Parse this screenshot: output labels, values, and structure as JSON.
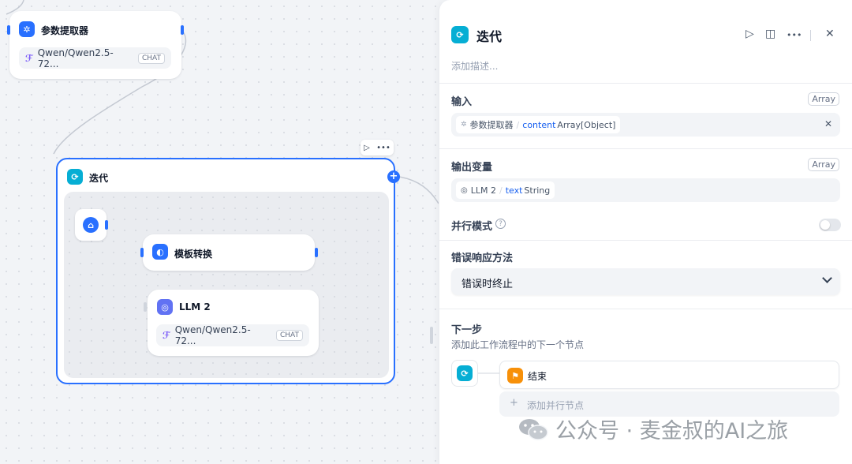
{
  "canvas": {
    "param_node": {
      "title": "参数提取器",
      "model": "Qwen/Qwen2.5-72...",
      "tag": "CHAT"
    },
    "iteration_node": {
      "title": "迭代"
    },
    "template_node": {
      "title": "模板转换"
    },
    "llm_node": {
      "title": "LLM 2",
      "model": "Qwen/Qwen2.5-72...",
      "tag": "CHAT"
    }
  },
  "panel": {
    "title": "迭代",
    "description_placeholder": "添加描述...",
    "input": {
      "label": "输入",
      "type_badge": "Array",
      "source_node": "参数提取器",
      "separator": "/",
      "var_name": "content",
      "var_type": "Array[Object]"
    },
    "output": {
      "label": "输出变量",
      "type_badge": "Array",
      "source_node": "LLM 2",
      "separator": "/",
      "var_name": "text",
      "var_type": "String"
    },
    "parallel": {
      "label": "并行模式",
      "enabled": false
    },
    "error_handling": {
      "label": "错误响应方法",
      "selected": "错误时终止"
    },
    "next_step": {
      "label": "下一步",
      "description": "添加此工作流程中的下一个节点",
      "next_node": "结束",
      "add_parallel": "添加并行节点"
    }
  },
  "watermark": {
    "text": "公众号 · 麦金叔的AI之旅"
  },
  "colors": {
    "accent": "#2970ff",
    "iteration_icon": "#06aed4",
    "end_icon": "#f79009",
    "llm_icon": "#6172f3"
  },
  "icons": [
    "play-icon",
    "split-view-icon",
    "more-icon",
    "close-icon",
    "help-icon",
    "chevron-down-icon",
    "plus-icon",
    "home-icon",
    "wechat-icon"
  ]
}
